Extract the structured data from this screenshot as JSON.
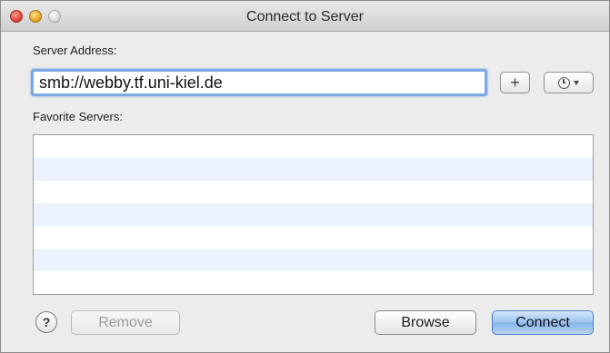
{
  "window": {
    "title": "Connect to Server"
  },
  "server_address": {
    "label": "Server Address:",
    "value": "smb://webby.tf.uni-kiel.de",
    "add_button_label": "+",
    "recent_icon": "clock-icon"
  },
  "favorites": {
    "label": "Favorite Servers:",
    "items": []
  },
  "buttons": {
    "help_label": "?",
    "remove_label": "Remove",
    "browse_label": "Browse",
    "connect_label": "Connect"
  },
  "colors": {
    "accent": "#7aa9e6",
    "stripe": "#edf3fe",
    "default_button": "#9cc3f0"
  }
}
